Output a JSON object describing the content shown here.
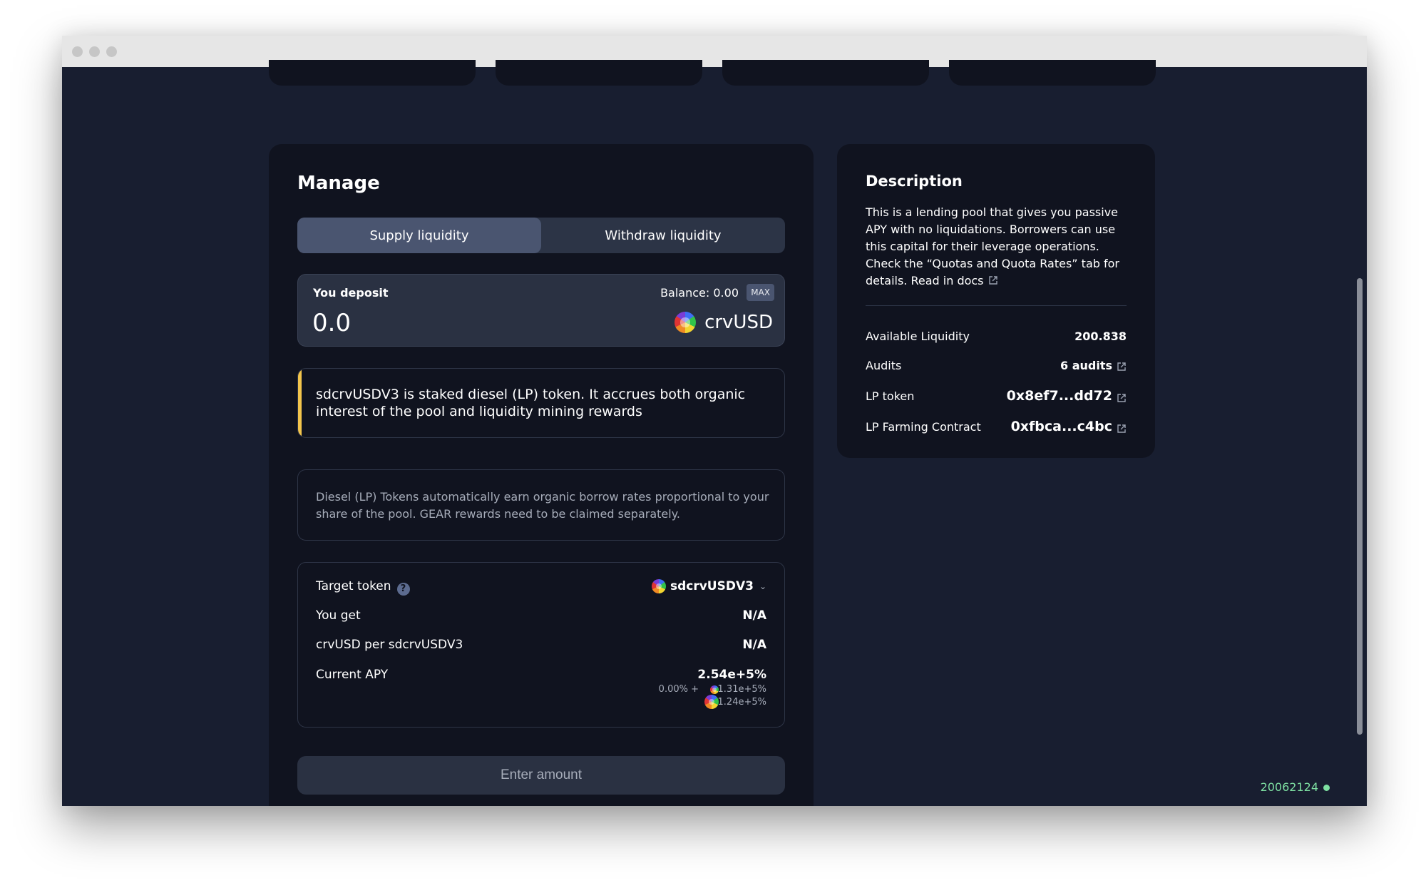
{
  "manage": {
    "title": "Manage",
    "tabs": [
      {
        "label": "Supply liquidity",
        "active": true
      },
      {
        "label": "Withdraw liquidity",
        "active": false
      }
    ],
    "deposit": {
      "label": "You deposit",
      "balance": "Balance: 0.00",
      "max_label": "MAX",
      "amount_placeholder": "0.0",
      "token": "crvUSD"
    },
    "alert_text": "sdcrvUSDV3 is staked diesel (LP) token. It accrues both organic interest of the pool and liquidity mining rewards",
    "info_text": "Diesel (LP) Tokens automatically earn organic borrow rates proportional to your share of the pool. GEAR rewards need to be claimed separately.",
    "summary": {
      "target_token_label": "Target token",
      "target_token_value": "sdcrvUSDV3",
      "you_get_label": "You get",
      "you_get_value": "N/A",
      "rate_label": "crvUSD per sdcrvUSDV3",
      "rate_value": "N/A",
      "apy_label": "Current APY",
      "apy_total": "2.54e+5%",
      "apy_base": "0.00% +",
      "apy_reward_1": "1.31e+5%",
      "apy_reward_2": "1.24e+5%"
    },
    "submit_label": "Enter amount"
  },
  "description": {
    "title": "Description",
    "body": "This is a lending pool that gives you passive APY with no liquidations. Borrowers can use this capital for their leverage operations. Check the “Quotas and Quota Rates” tab for details. Read in docs",
    "rows": [
      {
        "label": "Available Liquidity",
        "value": "200.838"
      },
      {
        "label": "Audits",
        "value": "6 audits"
      },
      {
        "label": "LP token",
        "value": "0x8ef7...dd72"
      },
      {
        "label": "LP Farming Contract",
        "value": "0xfbca...c4bc"
      }
    ]
  },
  "footer": {
    "block_number": "20062124"
  },
  "colors": {
    "background": "#181e30",
    "card": "#10131f",
    "accent_warning": "#f3c54c",
    "status_green": "#7ee0a2"
  },
  "icons": [
    "external-link-icon",
    "help-icon",
    "chevron-down-icon",
    "crvusd-token-icon",
    "sdcrvusdv3-token-icon"
  ]
}
